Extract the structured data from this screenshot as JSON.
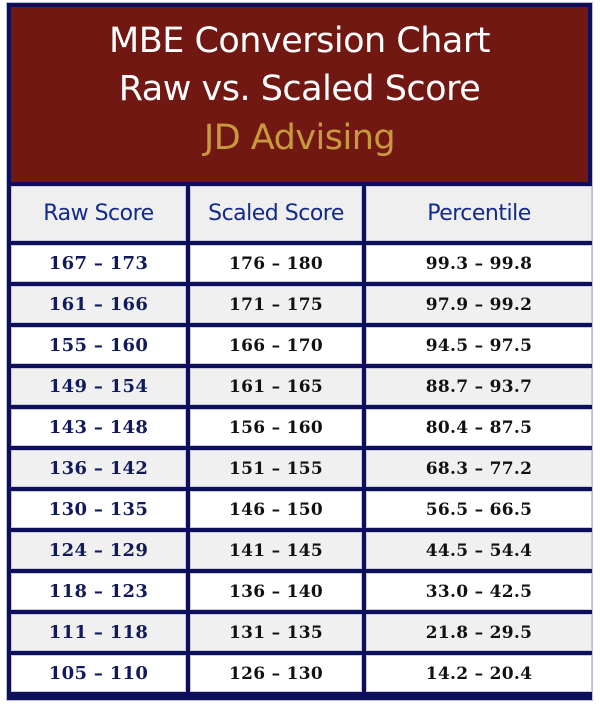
{
  "header": {
    "title_line1": "MBE Conversion Chart",
    "title_line2": "Raw vs. Scaled Score",
    "brand": "JD Advising"
  },
  "colors": {
    "banner_bg": "#721813",
    "brand_gold": "#c99a3c",
    "border_navy": "#0e0f5c",
    "header_text_blue": "#122a8a"
  },
  "table": {
    "columns": [
      "Raw Score",
      "Scaled Score",
      "Percentile"
    ],
    "rows": [
      {
        "raw": "167 – 173",
        "scaled": "176 – 180",
        "percentile": "99.3 – 99.8"
      },
      {
        "raw": "161 – 166",
        "scaled": "171 – 175",
        "percentile": "97.9 – 99.2"
      },
      {
        "raw": "155 – 160",
        "scaled": "166 – 170",
        "percentile": "94.5 – 97.5"
      },
      {
        "raw": "149 – 154",
        "scaled": "161 – 165",
        "percentile": "88.7 – 93.7"
      },
      {
        "raw": "143 – 148",
        "scaled": "156 – 160",
        "percentile": "80.4 – 87.5"
      },
      {
        "raw": "136 – 142",
        "scaled": "151 – 155",
        "percentile": "68.3 – 77.2"
      },
      {
        "raw": "130 – 135",
        "scaled": "146 – 150",
        "percentile": "56.5 – 66.5"
      },
      {
        "raw": "124 – 129",
        "scaled": "141 – 145",
        "percentile": "44.5 – 54.4"
      },
      {
        "raw": "118 – 123",
        "scaled": "136 – 140",
        "percentile": "33.0 – 42.5"
      },
      {
        "raw": "111 – 118",
        "scaled": "131 – 135",
        "percentile": "21.8 – 29.5"
      },
      {
        "raw": "105 – 110",
        "scaled": "126 – 130",
        "percentile": "14.2 – 20.4"
      }
    ]
  }
}
